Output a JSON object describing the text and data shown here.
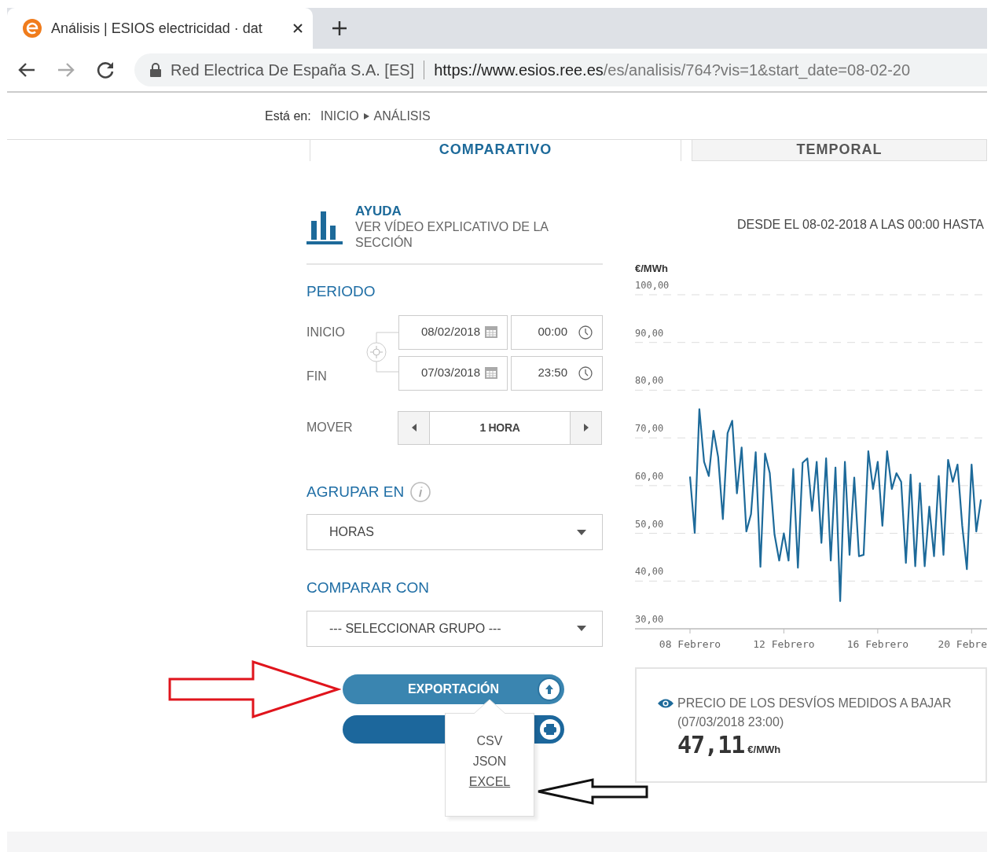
{
  "browser": {
    "tab": {
      "title": "Análisis | ESIOS electricidad · dat",
      "selected": true
    },
    "forward_disabled": true,
    "site_identity": "Red Electrica De España S.A. [ES]",
    "url_host": "https://www.esios.ree.es",
    "url_path": "/es/analisis/764?vis=1&start_date=08-02-20"
  },
  "breadcrumb": {
    "label": "Está en:",
    "items": [
      "INICIO",
      "ANÁLISIS"
    ]
  },
  "view_tabs": [
    {
      "label": "COMPARATIVO",
      "selected": true
    },
    {
      "label": "TEMPORAL",
      "selected": false
    }
  ],
  "help": {
    "title": "AYUDA",
    "link": "VER VÍDEO EXPLICATIVO DE LA SECCIÓN"
  },
  "period": {
    "title": "PERIODO",
    "rows": [
      {
        "label": "INICIO",
        "date": "08/02/2018",
        "time": "00:00"
      },
      {
        "label": "FIN",
        "date": "07/03/2018",
        "time": "23:50"
      }
    ]
  },
  "move": {
    "label": "MOVER",
    "value": "1 HORA"
  },
  "group": {
    "title": "AGRUPAR EN",
    "value": "HORAS"
  },
  "compare": {
    "title": "COMPARAR CON",
    "value": "--- SELECCIONAR GRUPO ---"
  },
  "export": {
    "label": "EXPORTACIÓN",
    "expanded": true,
    "options": [
      {
        "label": "CSV",
        "hovered": false
      },
      {
        "label": "JSON",
        "hovered": false
      },
      {
        "label": "EXCEL",
        "hovered": true
      }
    ]
  },
  "chart": {
    "range_text": "DESDE EL 08-02-2018 A LAS 00:00 HASTA",
    "chart_data": {
      "type": "line",
      "grid": true,
      "ylabel": "€/MWh",
      "ylim": [
        30,
        100
      ],
      "yticks": [
        {
          "value": 100,
          "label": "100,00"
        },
        {
          "value": 90,
          "label": "90,00"
        },
        {
          "value": 80,
          "label": "80,00"
        },
        {
          "value": 70,
          "label": "70,00"
        },
        {
          "value": 60,
          "label": "60,00"
        },
        {
          "value": 50,
          "label": "50,00"
        },
        {
          "value": 40,
          "label": "40,00"
        },
        {
          "value": 30,
          "label": "30,00"
        }
      ],
      "categories": [
        "08 Febrero",
        null,
        null,
        null,
        null,
        null,
        null,
        null,
        null,
        null,
        null,
        null,
        null,
        null,
        null,
        null,
        null,
        null,
        null,
        null,
        "12 Febrero",
        null,
        null,
        null,
        null,
        null,
        null,
        null,
        null,
        null,
        null,
        null,
        null,
        null,
        null,
        null,
        null,
        null,
        null,
        null,
        "16 Febrero",
        null,
        null,
        null,
        null,
        null,
        null,
        null,
        null,
        null,
        null,
        null,
        null,
        null,
        null,
        null,
        null,
        null,
        null,
        null,
        "20 Febre",
        null,
        null
      ],
      "series": [
        {
          "color": "#1d6a9a",
          "values": [
            61.9,
            50.1,
            76,
            65,
            62,
            71.5,
            66,
            53,
            71,
            73.6,
            58.4,
            68,
            50.4,
            54,
            67,
            43,
            66.7,
            62.6,
            49.8,
            44.3,
            50,
            44.3,
            63.5,
            42.8,
            64.8,
            65.7,
            54.7,
            65,
            48,
            65.7,
            44.3,
            63.8,
            35.8,
            65,
            45.5,
            61.7,
            45.2,
            45.5,
            67.2,
            59.3,
            65,
            51.6,
            67.2,
            59.3,
            62.6,
            60.8,
            43.8,
            62.3,
            43.1,
            60.5,
            43.1,
            55.6,
            45.2,
            62,
            45.5,
            65.4,
            60.8,
            64.4,
            51.6,
            42.5,
            64.4,
            50.4,
            57.1
          ]
        }
      ]
    }
  },
  "indicator": {
    "title": "PRECIO DE LOS DESVÍOS MEDIDOS A BAJAR",
    "timestamp": "(07/03/2018 23:00)",
    "value": "47,11",
    "unit": "€/MWh"
  }
}
